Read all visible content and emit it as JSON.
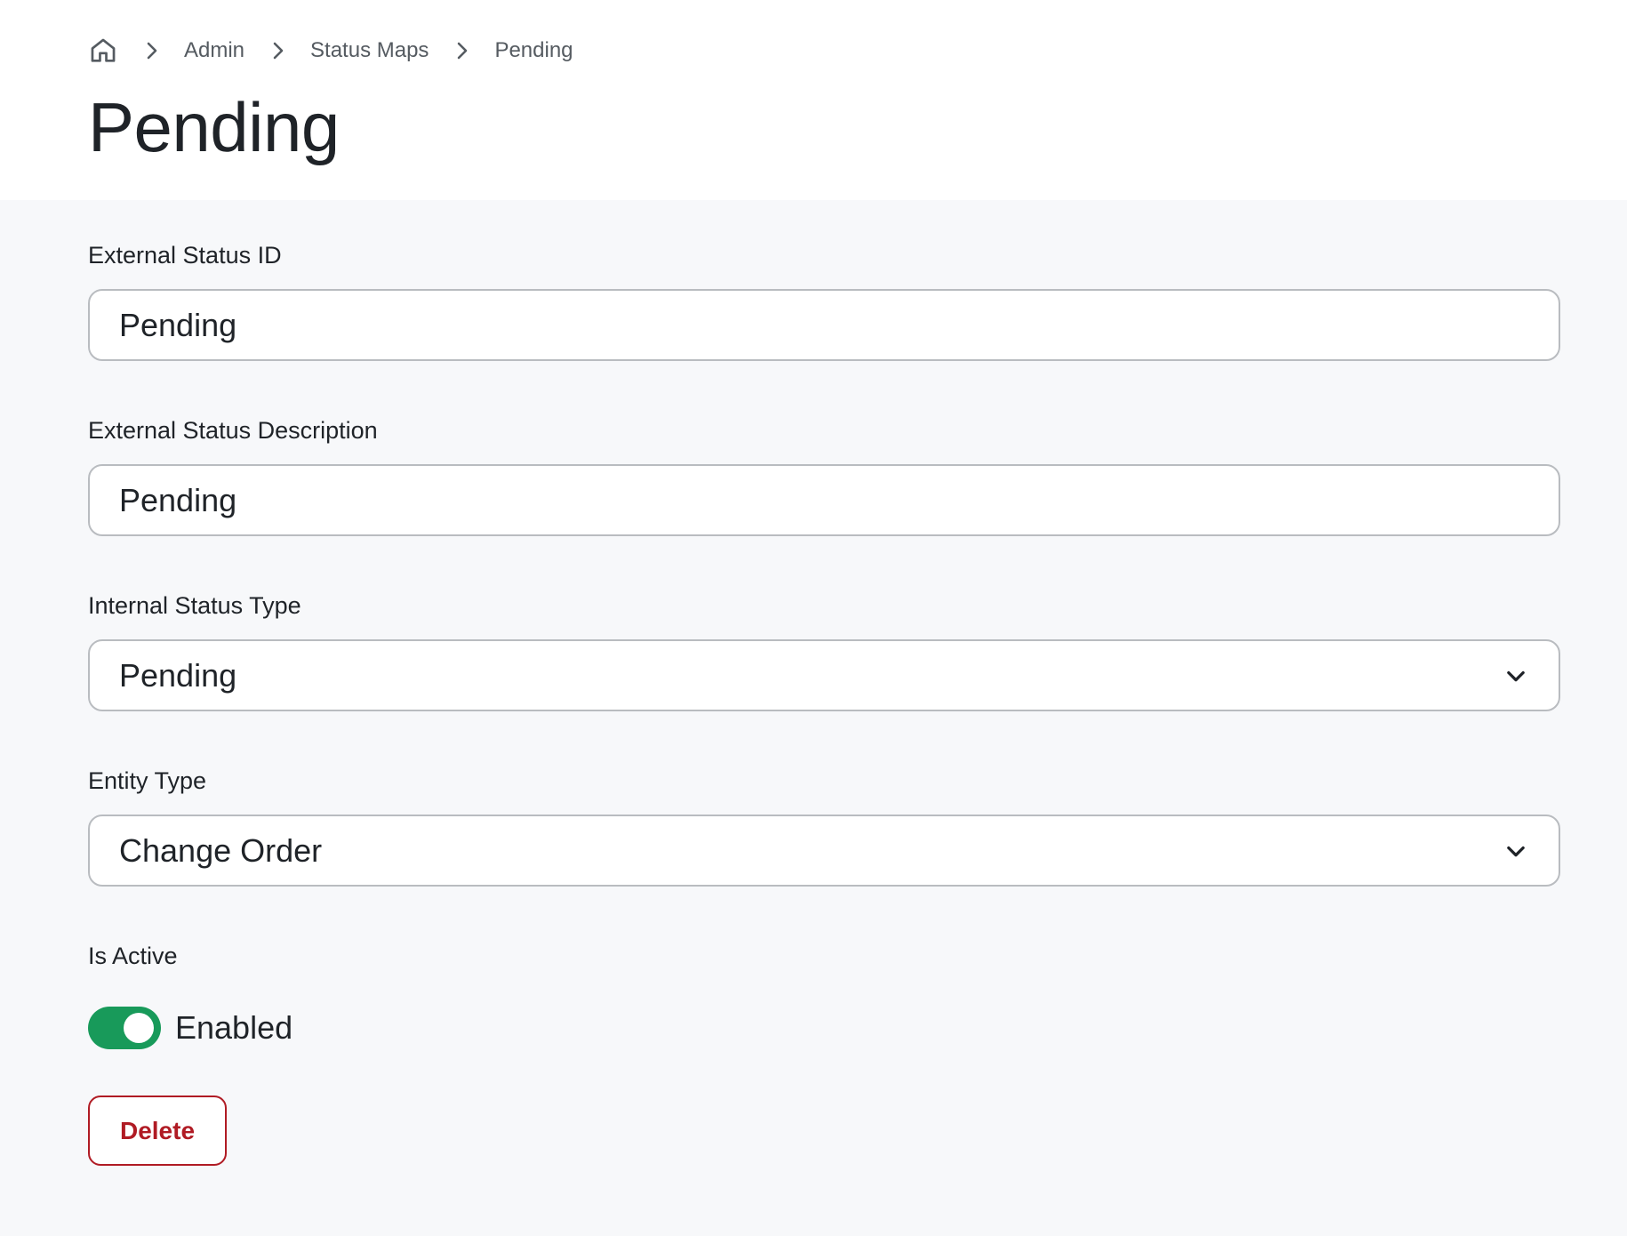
{
  "breadcrumb": {
    "home_icon": "home-icon",
    "separator_icon": "chevron-right-icon",
    "items": [
      {
        "label": "Admin"
      },
      {
        "label": "Status Maps"
      },
      {
        "label": "Pending"
      }
    ]
  },
  "page": {
    "title": "Pending"
  },
  "form": {
    "external_status_id": {
      "label": "External Status ID",
      "value": "Pending"
    },
    "external_status_description": {
      "label": "External Status Description",
      "value": "Pending"
    },
    "internal_status_type": {
      "label": "Internal Status Type",
      "selected": "Pending",
      "icon": "chevron-down-icon"
    },
    "entity_type": {
      "label": "Entity Type",
      "selected": "Change Order",
      "icon": "chevron-down-icon"
    },
    "is_active": {
      "label": "Is Active",
      "state_label": "Enabled",
      "on": true
    },
    "delete_label": "Delete"
  },
  "colors": {
    "toggle_on": "#189a5a",
    "danger": "#b01b24",
    "background": "#f7f8fa",
    "header_background": "#ffffff"
  }
}
